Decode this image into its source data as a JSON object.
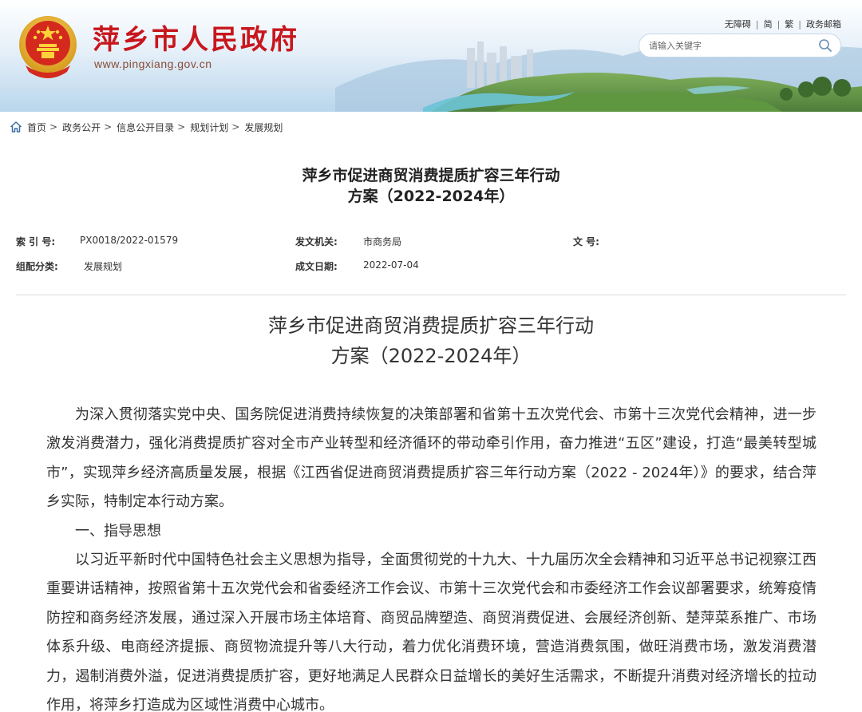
{
  "header": {
    "title": "萍乡市人民政府",
    "domain": "www.pingxiang.gov.cn",
    "links": [
      "无障碍",
      "简",
      "繁",
      "政务邮箱"
    ],
    "search_placeholder": "请输入关键字"
  },
  "breadcrumb": [
    "首页",
    "政务公开",
    "信息公开目录",
    "规划计划",
    "发展规划"
  ],
  "doc": {
    "title_line1": "萍乡市促进商贸消费提质扩容三年行动",
    "title_line2": "方案（2022-2024年）"
  },
  "meta": {
    "index_label": "索 引 号:",
    "index_value": "PX0018/2022-01579",
    "issuer_label": "发文机关:",
    "issuer_value": "市商务局",
    "docno_label": "文 号:",
    "docno_value": "",
    "category_label": "组配分类:",
    "category_value": "发展规划",
    "date_label": "成文日期:",
    "date_value": "2022-07-04"
  },
  "body": {
    "title_line1": "萍乡市促进商贸消费提质扩容三年行动",
    "title_line2": "方案（2022-2024年）",
    "para1": "为深入贯彻落实党中央、国务院促进消费持续恢复的决策部署和省第十五次党代会、市第十三次党代会精神，进一步激发消费潜力，强化消费提质扩容对全市产业转型和经济循环的带动牵引作用，奋力推进“五区”建设，打造“最美转型城市”，实现萍乡经济高质量发展，根据《江西省促进商贸消费提质扩容三年行动方案（2022 - 2024年）》的要求，结合萍乡实际，特制定本行动方案。",
    "heading1": "一、指导思想",
    "para2": "以习近平新时代中国特色社会主义思想为指导，全面贯彻党的十九大、十九届历次全会精神和习近平总书记视察江西重要讲话精神，按照省第十五次党代会和省委经济工作会议、市第十三次党代会和市委经济工作会议部署要求，统筹疫情防控和商务经济发展，通过深入开展市场主体培育、商贸品牌塑造、商贸消费促进、会展经济创新、楚萍菜系推广、市场体系升级、电商经济提振、商贸物流提升等八大行动，着力优化消费环境，营造消费氛围，做旺消费市场，激发消费潜力，遏制消费外溢，促进消费提质扩容，更好地满足人民群众日益增长的美好生活需求，不断提升消费对经济增长的拉动作用，将萍乡打造成为区域性消费中心城市。"
  },
  "colors": {
    "title_red": "#c8161d",
    "text": "#333333",
    "divider": "#dcdcdc"
  }
}
